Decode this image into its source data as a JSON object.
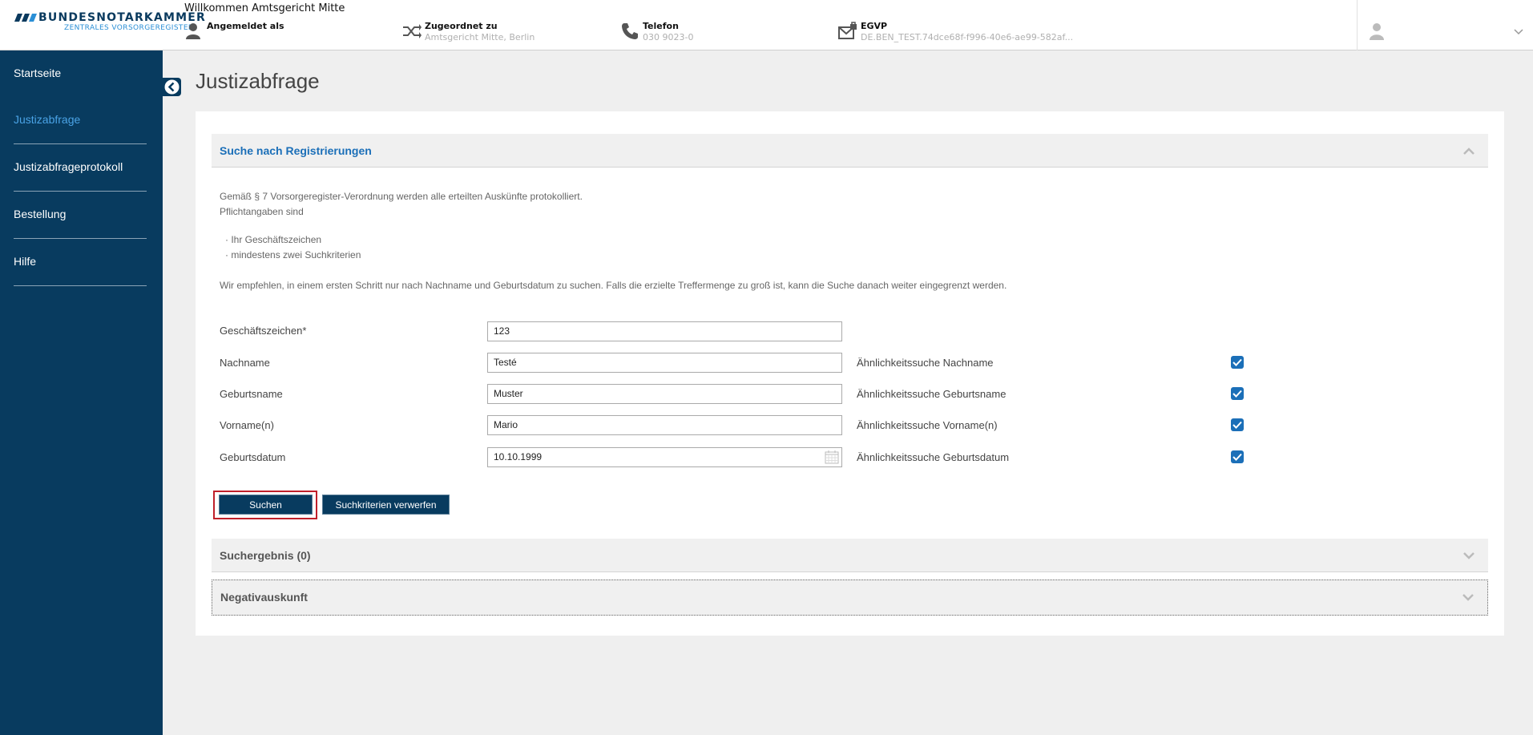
{
  "header": {
    "brand": "BUNDESNOTARKAMMER",
    "brand_sub": "ZENTRALES VORSORGEREGISTER",
    "welcome": "Willkommen Amtsgericht Mitte",
    "logged_in_label": "Angemeldet als",
    "assigned_label": "Zugeordnet zu",
    "assigned_value": "Amtsgericht Mitte, Berlin",
    "phone_label": "Telefon",
    "phone_value": "030 9023-0",
    "egvp_label": "EGVP",
    "egvp_value": "DE.BEN_TEST.74dce68f-f996-40e6-ae99-582af..."
  },
  "sidebar": {
    "items": [
      {
        "label": "Startseite",
        "active": false
      },
      {
        "label": "Justizabfrage",
        "active": true
      },
      {
        "label": "Justizabfrageprotokoll",
        "active": false
      },
      {
        "label": "Bestellung",
        "active": false
      },
      {
        "label": "Hilfe",
        "active": false
      }
    ]
  },
  "main": {
    "title": "Justizabfrage",
    "search_panel": {
      "title": "Suche nach Registrierungen",
      "intro_line1": "Gemäß § 7 Vorsorgeregister-Verordnung werden alle erteilten Auskünfte protokolliert.",
      "intro_line2": "Pflichtangaben sind",
      "bullet1": "· Ihr Geschäftszeichen",
      "bullet2": "· mindestens zwei Suchkriterien",
      "recommendation": "Wir empfehlen, in einem ersten Schritt nur nach Nachname und Geburtsdatum zu suchen. Falls die erzielte Treffermenge zu groß ist, kann die Suche danach weiter eingegrenzt werden.",
      "fields": {
        "reference_label": "Geschäftszeichen*",
        "reference_value": "123",
        "lastname_label": "Nachname",
        "lastname_value": "Testé",
        "lastname_similar_label": "Ähnlichkeitssuche Nachname",
        "birthname_label": "Geburtsname",
        "birthname_value": "Muster",
        "birthname_similar_label": "Ähnlichkeitssuche Geburtsname",
        "firstname_label": "Vorname(n)",
        "firstname_value": "Mario",
        "firstname_similar_label": "Ähnlichkeitssuche Vorname(n)",
        "birthdate_label": "Geburtsdatum",
        "birthdate_value": "10.10.1999",
        "birthdate_similar_label": "Ähnlichkeitssuche Geburtsdatum"
      },
      "search_button": "Suchen",
      "reset_button": "Suchkriterien verwerfen"
    },
    "result_panel": {
      "title": "Suchergebnis (0)"
    },
    "negative_panel": {
      "title": "Negativauskunft"
    }
  },
  "colors": {
    "sidebar_bg": "#083b5f",
    "accent": "#1b6fb8",
    "active_nav": "#4aa3e6",
    "focus_ring": "#c0202a"
  }
}
